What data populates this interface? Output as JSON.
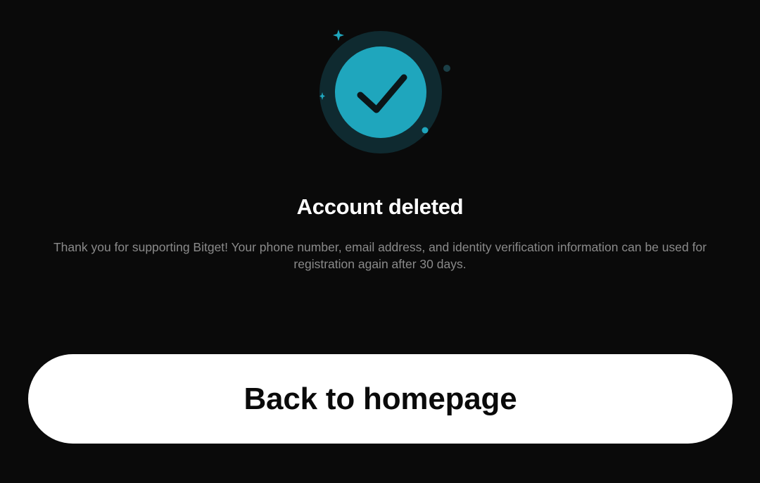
{
  "screen": {
    "title": "Account deleted",
    "message": "Thank you for supporting Bitget!  Your phone number, email address, and identity verification information can be used for registration again after 30 days.",
    "primary_button_label": "Back to homepage"
  },
  "icons": {
    "success": "check-circle-icon",
    "decor": [
      "sparkle-icon",
      "dot-icon"
    ]
  },
  "colors": {
    "background": "#0a0a0a",
    "accent": "#1fa6bd",
    "accent_ring": "#0f2a30",
    "title": "#ffffff",
    "message": "#8a8a8a",
    "button_bg": "#ffffff",
    "button_text": "#0a0a0a"
  }
}
